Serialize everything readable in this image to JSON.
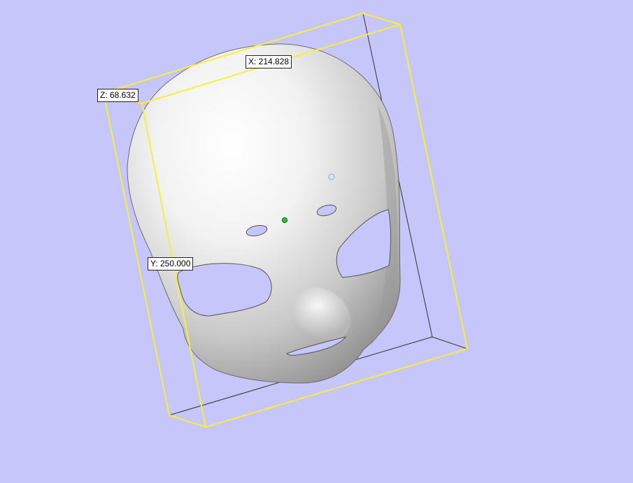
{
  "viewport": {
    "background_color": "#c6c6fa",
    "bbox_color": "#f5f03c",
    "model": "face-mask-mesh"
  },
  "dimensions": {
    "x_label": "X: 214.828",
    "y_label": "Y: 250.000",
    "z_label": "Z: 68.632"
  },
  "markers": {
    "center_color": "#22cc22",
    "pivot_color": "#8fb6e0"
  }
}
